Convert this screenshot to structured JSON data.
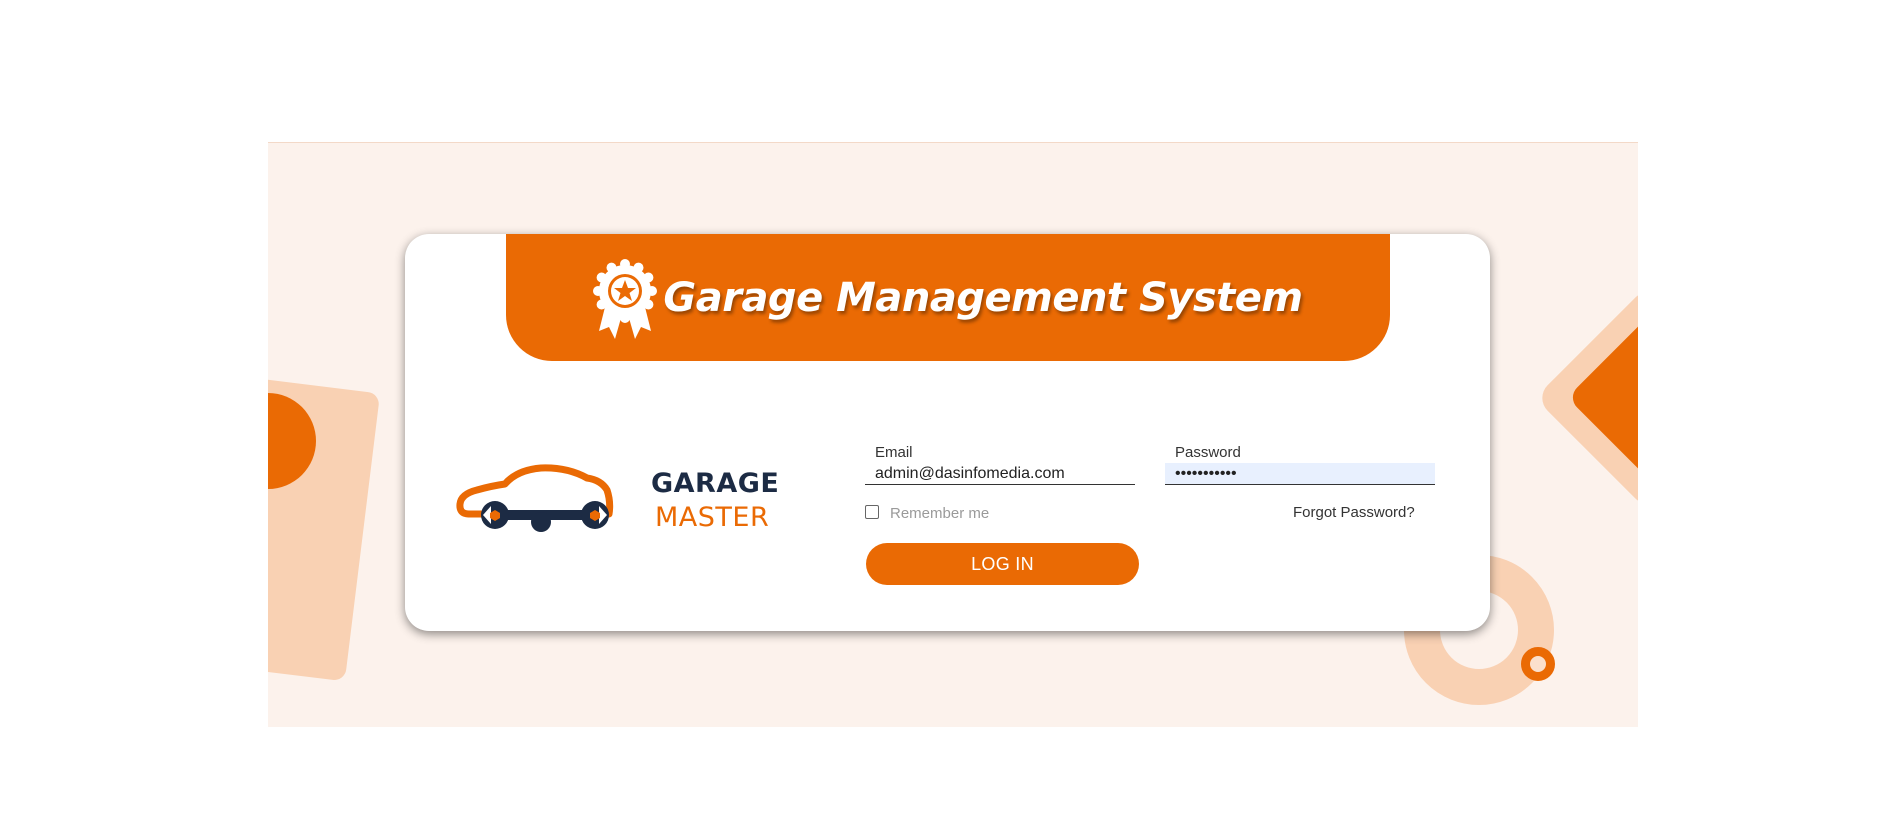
{
  "header": {
    "title": "Garage Management System",
    "icon": "award-ribbon-icon"
  },
  "logo": {
    "line1": "GARAGE",
    "line2": "MASTER",
    "icon": "car-wrench-icon"
  },
  "form": {
    "email": {
      "label": "Email",
      "value": "admin@dasinfomedia.com"
    },
    "password": {
      "label": "Password",
      "value": "•••••••••••"
    },
    "remember_label": "Remember me",
    "remember_checked": false,
    "forgot_label": "Forgot Password?",
    "login_label": "LOG IN"
  },
  "colors": {
    "accent": "#ea6a04",
    "background": "#fcf2ec",
    "deco_light": "#f9d1b3",
    "logo_dark": "#1c2b44"
  }
}
